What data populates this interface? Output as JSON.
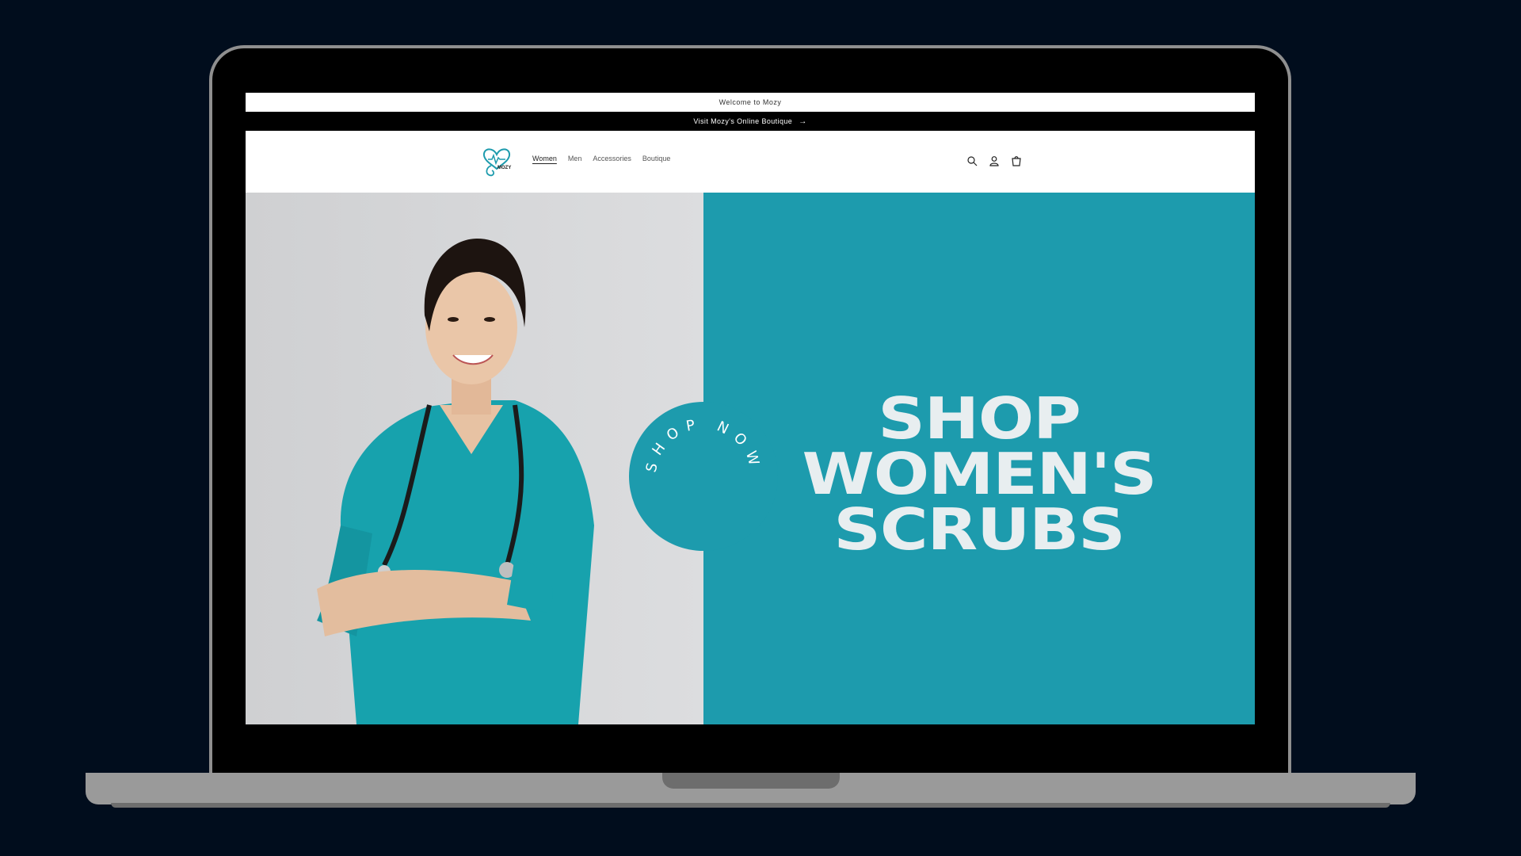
{
  "announcement": {
    "welcome": "Welcome to Mozy",
    "promo": "Visit Mozy's Online Boutique",
    "promo_arrow": "→"
  },
  "header": {
    "logo_text": "MOZY",
    "nav": [
      "Women",
      "Men",
      "Accessories",
      "Boutique"
    ],
    "active_nav": "Women"
  },
  "hero": {
    "circle_text": "SHOP NOW",
    "title_lines": [
      "SHOP",
      "WOMEN'S",
      "SCRUBS"
    ]
  },
  "colors": {
    "page_bg": "#010d1d",
    "accent": "#1d9bad",
    "hero_text": "#e8eef0"
  }
}
